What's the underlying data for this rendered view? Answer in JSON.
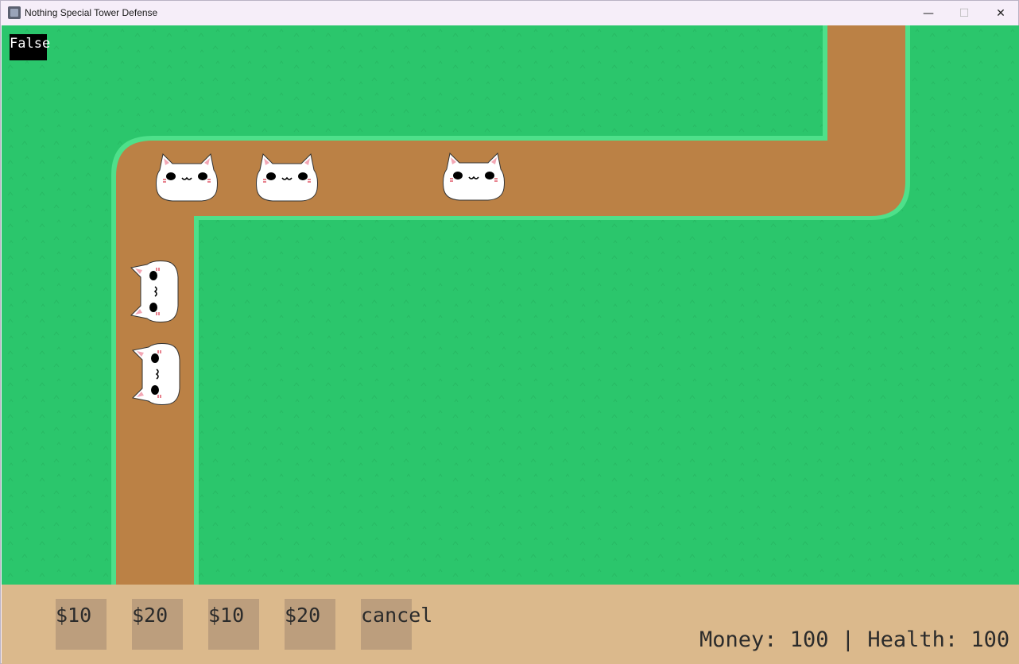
{
  "window": {
    "title": "Nothing Special Tower Defense",
    "minimize_glyph": "—",
    "maximize_glyph": "☐",
    "close_glyph": "✕"
  },
  "debug": {
    "text": "False"
  },
  "path_colors": {
    "grass": "#2bc66c",
    "dirt": "#bb8145",
    "edge": "#4ee08a"
  },
  "enemies": [
    {
      "type": "cat",
      "facing": "up"
    },
    {
      "type": "cat",
      "facing": "up"
    },
    {
      "type": "cat",
      "facing": "up"
    },
    {
      "type": "cat",
      "facing": "left"
    },
    {
      "type": "cat",
      "facing": "left"
    }
  ],
  "shop": {
    "buttons": [
      {
        "label": "$10"
      },
      {
        "label": "$20"
      },
      {
        "label": "$10"
      },
      {
        "label": "$20"
      },
      {
        "label": "cancel"
      }
    ]
  },
  "status": {
    "text": "Money: 100 | Health: 100",
    "money": 100,
    "health": 100
  }
}
